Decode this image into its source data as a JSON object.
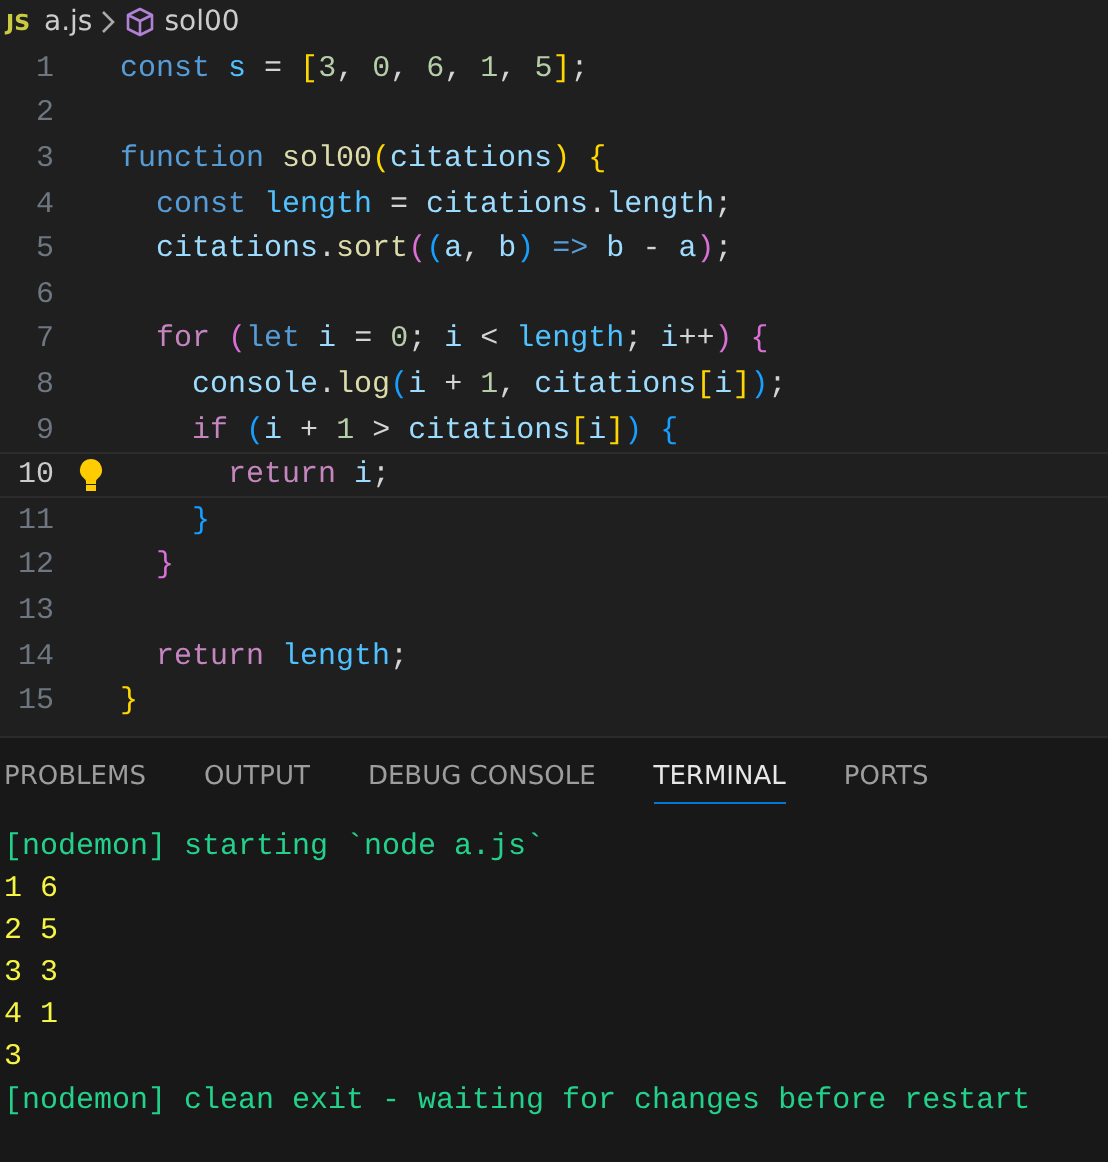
{
  "breadcrumb": {
    "file_badge": "JS",
    "file": "a.js",
    "symbol": "sol00"
  },
  "code_lines": [
    {
      "number": "1",
      "current": false,
      "lightbulb": false,
      "tokens": [
        {
          "kind": "keyword",
          "text": "const"
        },
        {
          "kind": "constant",
          "text": " s"
        },
        {
          "kind": "plain",
          "text": " = "
        },
        {
          "kind": "bracket1",
          "text": "["
        },
        {
          "kind": "number",
          "text": "3"
        },
        {
          "kind": "plain",
          "text": ", "
        },
        {
          "kind": "number",
          "text": "0"
        },
        {
          "kind": "plain",
          "text": ", "
        },
        {
          "kind": "number",
          "text": "6"
        },
        {
          "kind": "plain",
          "text": ", "
        },
        {
          "kind": "number",
          "text": "1"
        },
        {
          "kind": "plain",
          "text": ", "
        },
        {
          "kind": "number",
          "text": "5"
        },
        {
          "kind": "bracket1",
          "text": "]"
        },
        {
          "kind": "plain",
          "text": ";"
        }
      ]
    },
    {
      "number": "2",
      "current": false,
      "lightbulb": false
    },
    {
      "number": "3",
      "current": false,
      "lightbulb": false,
      "tokens": [
        {
          "kind": "keyword",
          "text": "function"
        },
        {
          "kind": "function",
          "text": " sol00"
        },
        {
          "kind": "bracket1",
          "text": "("
        },
        {
          "kind": "variable",
          "text": "citations"
        },
        {
          "kind": "bracket1",
          "text": ")"
        },
        {
          "kind": "bracket1",
          "text": " {"
        }
      ]
    },
    {
      "number": "4",
      "current": false,
      "lightbulb": false,
      "tokens": [
        {
          "kind": "keyword",
          "text": "  const"
        },
        {
          "kind": "constant",
          "text": " length"
        },
        {
          "kind": "plain",
          "text": " = "
        },
        {
          "kind": "variable",
          "text": "citations"
        },
        {
          "kind": "plain",
          "text": "."
        },
        {
          "kind": "variable",
          "text": "length"
        },
        {
          "kind": "plain",
          "text": ";"
        }
      ]
    },
    {
      "number": "5",
      "current": false,
      "lightbulb": false,
      "tokens": [
        {
          "kind": "variable",
          "text": "  citations"
        },
        {
          "kind": "plain",
          "text": "."
        },
        {
          "kind": "function",
          "text": "sort"
        },
        {
          "kind": "bracket2",
          "text": "("
        },
        {
          "kind": "bracket3",
          "text": "("
        },
        {
          "kind": "variable",
          "text": "a"
        },
        {
          "kind": "plain",
          "text": ", "
        },
        {
          "kind": "variable",
          "text": "b"
        },
        {
          "kind": "bracket3",
          "text": ")"
        },
        {
          "kind": "keyword",
          "text": " =>"
        },
        {
          "kind": "variable",
          "text": " b"
        },
        {
          "kind": "plain",
          "text": " - "
        },
        {
          "kind": "variable",
          "text": "a"
        },
        {
          "kind": "bracket2",
          "text": ")"
        },
        {
          "kind": "plain",
          "text": ";"
        }
      ]
    },
    {
      "number": "6",
      "current": false,
      "lightbulb": false
    },
    {
      "number": "7",
      "current": false,
      "lightbulb": false,
      "tokens": [
        {
          "kind": "control",
          "text": "  for"
        },
        {
          "kind": "bracket2",
          "text": " ("
        },
        {
          "kind": "keyword",
          "text": "let"
        },
        {
          "kind": "variable",
          "text": " i"
        },
        {
          "kind": "plain",
          "text": " = "
        },
        {
          "kind": "number",
          "text": "0"
        },
        {
          "kind": "plain",
          "text": "; "
        },
        {
          "kind": "variable",
          "text": "i"
        },
        {
          "kind": "plain",
          "text": " < "
        },
        {
          "kind": "constant",
          "text": "length"
        },
        {
          "kind": "plain",
          "text": "; "
        },
        {
          "kind": "variable",
          "text": "i"
        },
        {
          "kind": "plain",
          "text": "++"
        },
        {
          "kind": "bracket2",
          "text": ")"
        },
        {
          "kind": "bracket2",
          "text": " {"
        }
      ]
    },
    {
      "number": "8",
      "current": false,
      "lightbulb": false,
      "tokens": [
        {
          "kind": "variable",
          "text": "    console"
        },
        {
          "kind": "plain",
          "text": "."
        },
        {
          "kind": "function",
          "text": "log"
        },
        {
          "kind": "bracket3",
          "text": "("
        },
        {
          "kind": "variable",
          "text": "i"
        },
        {
          "kind": "plain",
          "text": " + "
        },
        {
          "kind": "number",
          "text": "1"
        },
        {
          "kind": "plain",
          "text": ", "
        },
        {
          "kind": "variable",
          "text": "citations"
        },
        {
          "kind": "bracket1",
          "text": "["
        },
        {
          "kind": "variable",
          "text": "i"
        },
        {
          "kind": "bracket1",
          "text": "]"
        },
        {
          "kind": "bracket3",
          "text": ")"
        },
        {
          "kind": "plain",
          "text": ";"
        }
      ]
    },
    {
      "number": "9",
      "current": false,
      "lightbulb": false,
      "tokens": [
        {
          "kind": "control",
          "text": "    if"
        },
        {
          "kind": "bracket3",
          "text": " ("
        },
        {
          "kind": "variable",
          "text": "i"
        },
        {
          "kind": "plain",
          "text": " + "
        },
        {
          "kind": "number",
          "text": "1"
        },
        {
          "kind": "plain",
          "text": " > "
        },
        {
          "kind": "variable",
          "text": "citations"
        },
        {
          "kind": "bracket1",
          "text": "["
        },
        {
          "kind": "variable",
          "text": "i"
        },
        {
          "kind": "bracket1",
          "text": "]"
        },
        {
          "kind": "bracket3",
          "text": ")"
        },
        {
          "kind": "bracket3",
          "text": " {"
        }
      ]
    },
    {
      "number": "10",
      "current": true,
      "lightbulb": true,
      "tokens": [
        {
          "kind": "control",
          "text": "      return"
        },
        {
          "kind": "variable",
          "text": " i"
        },
        {
          "kind": "plain",
          "text": ";"
        }
      ]
    },
    {
      "number": "11",
      "current": false,
      "lightbulb": false,
      "tokens": [
        {
          "kind": "bracket3",
          "text": "    }"
        }
      ]
    },
    {
      "number": "12",
      "current": false,
      "lightbulb": false,
      "tokens": [
        {
          "kind": "bracket2",
          "text": "  }"
        }
      ]
    },
    {
      "number": "13",
      "current": false,
      "lightbulb": false
    },
    {
      "number": "14",
      "current": false,
      "lightbulb": false,
      "tokens": [
        {
          "kind": "control",
          "text": "  return"
        },
        {
          "kind": "constant",
          "text": " length"
        },
        {
          "kind": "plain",
          "text": ";"
        }
      ]
    },
    {
      "number": "15",
      "current": false,
      "lightbulb": false,
      "tokens": [
        {
          "kind": "bracket1",
          "text": "}"
        }
      ]
    }
  ],
  "panel_tabs": [
    {
      "label": "PROBLEMS",
      "selected": false
    },
    {
      "label": "OUTPUT",
      "selected": false
    },
    {
      "label": "DEBUG CONSOLE",
      "selected": false
    },
    {
      "label": "TERMINAL",
      "selected": true
    },
    {
      "label": "PORTS",
      "selected": false
    }
  ],
  "terminal_lines": [
    {
      "kind": "nodemon",
      "text": "[nodemon] starting `node a.js`"
    },
    {
      "kind": "output",
      "text": "1 6"
    },
    {
      "kind": "output",
      "text": "2 5"
    },
    {
      "kind": "output",
      "text": "3 3"
    },
    {
      "kind": "output",
      "text": "4 1"
    },
    {
      "kind": "output",
      "text": "3"
    },
    {
      "kind": "nodemon",
      "text": "[nodemon] clean exit - waiting for changes before restart"
    }
  ]
}
